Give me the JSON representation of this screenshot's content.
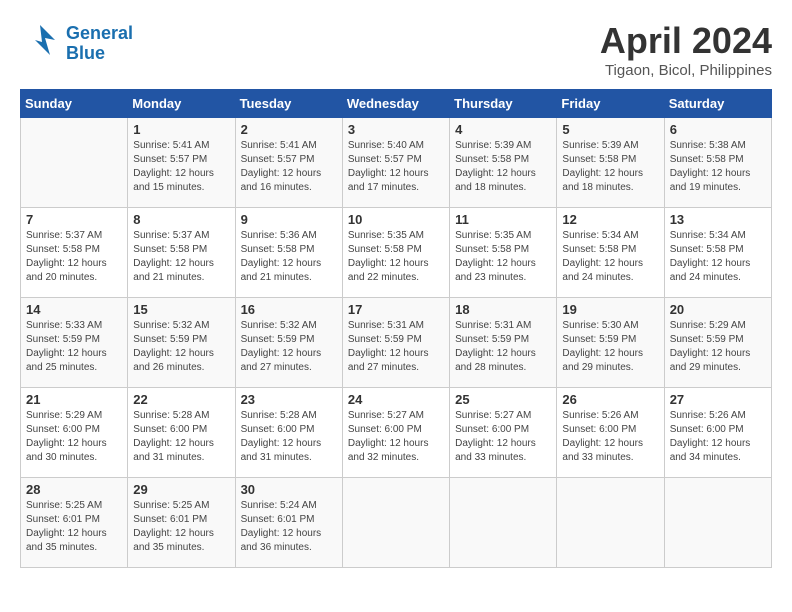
{
  "header": {
    "logo_line1": "General",
    "logo_line2": "Blue",
    "month": "April 2024",
    "location": "Tigaon, Bicol, Philippines"
  },
  "days_of_week": [
    "Sunday",
    "Monday",
    "Tuesday",
    "Wednesday",
    "Thursday",
    "Friday",
    "Saturday"
  ],
  "weeks": [
    [
      {
        "day": "",
        "content": ""
      },
      {
        "day": "1",
        "content": "Sunrise: 5:41 AM\nSunset: 5:57 PM\nDaylight: 12 hours\nand 15 minutes."
      },
      {
        "day": "2",
        "content": "Sunrise: 5:41 AM\nSunset: 5:57 PM\nDaylight: 12 hours\nand 16 minutes."
      },
      {
        "day": "3",
        "content": "Sunrise: 5:40 AM\nSunset: 5:57 PM\nDaylight: 12 hours\nand 17 minutes."
      },
      {
        "day": "4",
        "content": "Sunrise: 5:39 AM\nSunset: 5:58 PM\nDaylight: 12 hours\nand 18 minutes."
      },
      {
        "day": "5",
        "content": "Sunrise: 5:39 AM\nSunset: 5:58 PM\nDaylight: 12 hours\nand 18 minutes."
      },
      {
        "day": "6",
        "content": "Sunrise: 5:38 AM\nSunset: 5:58 PM\nDaylight: 12 hours\nand 19 minutes."
      }
    ],
    [
      {
        "day": "7",
        "content": "Sunrise: 5:37 AM\nSunset: 5:58 PM\nDaylight: 12 hours\nand 20 minutes."
      },
      {
        "day": "8",
        "content": "Sunrise: 5:37 AM\nSunset: 5:58 PM\nDaylight: 12 hours\nand 21 minutes."
      },
      {
        "day": "9",
        "content": "Sunrise: 5:36 AM\nSunset: 5:58 PM\nDaylight: 12 hours\nand 21 minutes."
      },
      {
        "day": "10",
        "content": "Sunrise: 5:35 AM\nSunset: 5:58 PM\nDaylight: 12 hours\nand 22 minutes."
      },
      {
        "day": "11",
        "content": "Sunrise: 5:35 AM\nSunset: 5:58 PM\nDaylight: 12 hours\nand 23 minutes."
      },
      {
        "day": "12",
        "content": "Sunrise: 5:34 AM\nSunset: 5:58 PM\nDaylight: 12 hours\nand 24 minutes."
      },
      {
        "day": "13",
        "content": "Sunrise: 5:34 AM\nSunset: 5:58 PM\nDaylight: 12 hours\nand 24 minutes."
      }
    ],
    [
      {
        "day": "14",
        "content": "Sunrise: 5:33 AM\nSunset: 5:59 PM\nDaylight: 12 hours\nand 25 minutes."
      },
      {
        "day": "15",
        "content": "Sunrise: 5:32 AM\nSunset: 5:59 PM\nDaylight: 12 hours\nand 26 minutes."
      },
      {
        "day": "16",
        "content": "Sunrise: 5:32 AM\nSunset: 5:59 PM\nDaylight: 12 hours\nand 27 minutes."
      },
      {
        "day": "17",
        "content": "Sunrise: 5:31 AM\nSunset: 5:59 PM\nDaylight: 12 hours\nand 27 minutes."
      },
      {
        "day": "18",
        "content": "Sunrise: 5:31 AM\nSunset: 5:59 PM\nDaylight: 12 hours\nand 28 minutes."
      },
      {
        "day": "19",
        "content": "Sunrise: 5:30 AM\nSunset: 5:59 PM\nDaylight: 12 hours\nand 29 minutes."
      },
      {
        "day": "20",
        "content": "Sunrise: 5:29 AM\nSunset: 5:59 PM\nDaylight: 12 hours\nand 29 minutes."
      }
    ],
    [
      {
        "day": "21",
        "content": "Sunrise: 5:29 AM\nSunset: 6:00 PM\nDaylight: 12 hours\nand 30 minutes."
      },
      {
        "day": "22",
        "content": "Sunrise: 5:28 AM\nSunset: 6:00 PM\nDaylight: 12 hours\nand 31 minutes."
      },
      {
        "day": "23",
        "content": "Sunrise: 5:28 AM\nSunset: 6:00 PM\nDaylight: 12 hours\nand 31 minutes."
      },
      {
        "day": "24",
        "content": "Sunrise: 5:27 AM\nSunset: 6:00 PM\nDaylight: 12 hours\nand 32 minutes."
      },
      {
        "day": "25",
        "content": "Sunrise: 5:27 AM\nSunset: 6:00 PM\nDaylight: 12 hours\nand 33 minutes."
      },
      {
        "day": "26",
        "content": "Sunrise: 5:26 AM\nSunset: 6:00 PM\nDaylight: 12 hours\nand 33 minutes."
      },
      {
        "day": "27",
        "content": "Sunrise: 5:26 AM\nSunset: 6:00 PM\nDaylight: 12 hours\nand 34 minutes."
      }
    ],
    [
      {
        "day": "28",
        "content": "Sunrise: 5:25 AM\nSunset: 6:01 PM\nDaylight: 12 hours\nand 35 minutes."
      },
      {
        "day": "29",
        "content": "Sunrise: 5:25 AM\nSunset: 6:01 PM\nDaylight: 12 hours\nand 35 minutes."
      },
      {
        "day": "30",
        "content": "Sunrise: 5:24 AM\nSunset: 6:01 PM\nDaylight: 12 hours\nand 36 minutes."
      },
      {
        "day": "",
        "content": ""
      },
      {
        "day": "",
        "content": ""
      },
      {
        "day": "",
        "content": ""
      },
      {
        "day": "",
        "content": ""
      }
    ]
  ]
}
